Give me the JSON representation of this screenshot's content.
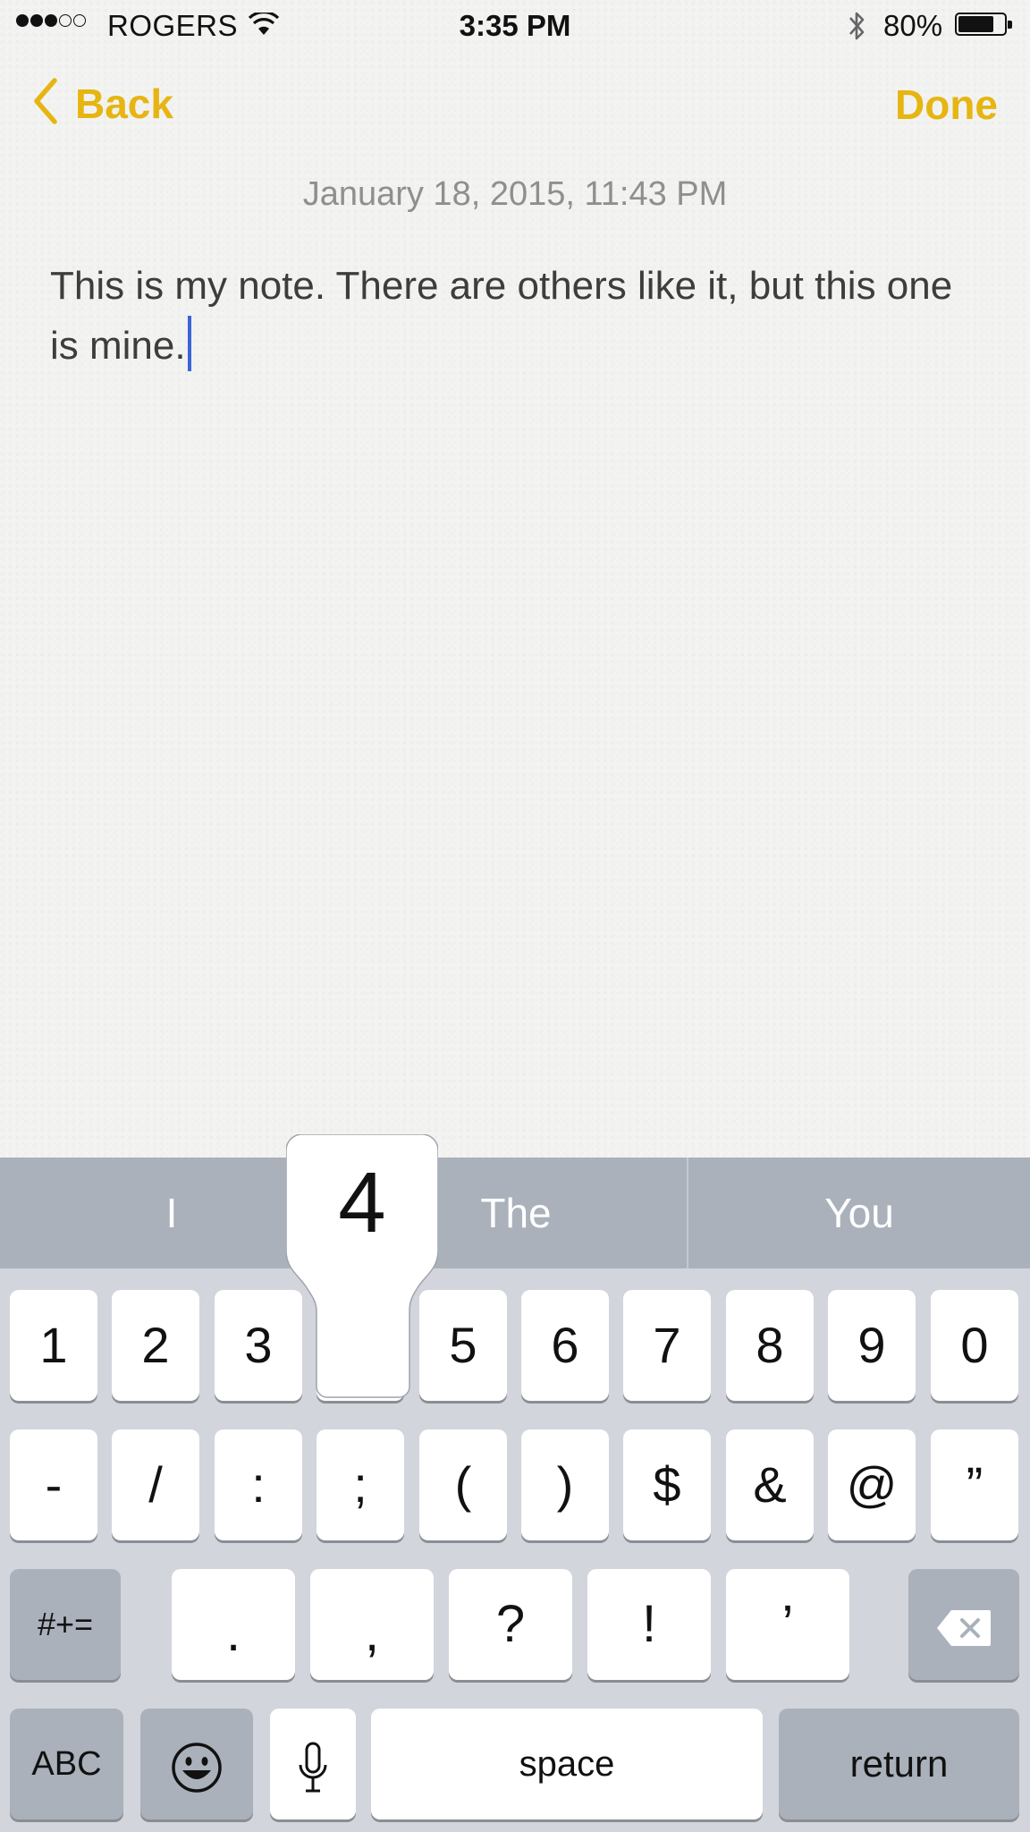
{
  "status_bar": {
    "signal_dots": [
      true,
      true,
      true,
      false,
      false
    ],
    "carrier": "ROGERS",
    "time": "3:35 PM",
    "battery_percent_label": "80%",
    "battery_level": 0.8
  },
  "nav": {
    "back_label": "Back",
    "done_label": "Done",
    "accent_color": "#e6b511"
  },
  "note": {
    "date": "January 18, 2015, 11:43 PM",
    "text": "This is my note. There are others like it, but this one is mine."
  },
  "keyboard": {
    "suggestions": [
      "I",
      "The",
      "You"
    ],
    "popup_key": "4",
    "row1": [
      "1",
      "2",
      "3",
      "4",
      "5",
      "6",
      "7",
      "8",
      "9",
      "0"
    ],
    "row2": [
      "-",
      "/",
      ":",
      ";",
      "(",
      ")",
      "$",
      "&",
      "@",
      "”"
    ],
    "row3": {
      "shift_label": "#+=",
      "keys": [
        ".",
        ",",
        "?",
        "!",
        "’"
      ]
    },
    "row4": {
      "abc_label": "ABC",
      "space_label": "space",
      "return_label": "return"
    }
  }
}
